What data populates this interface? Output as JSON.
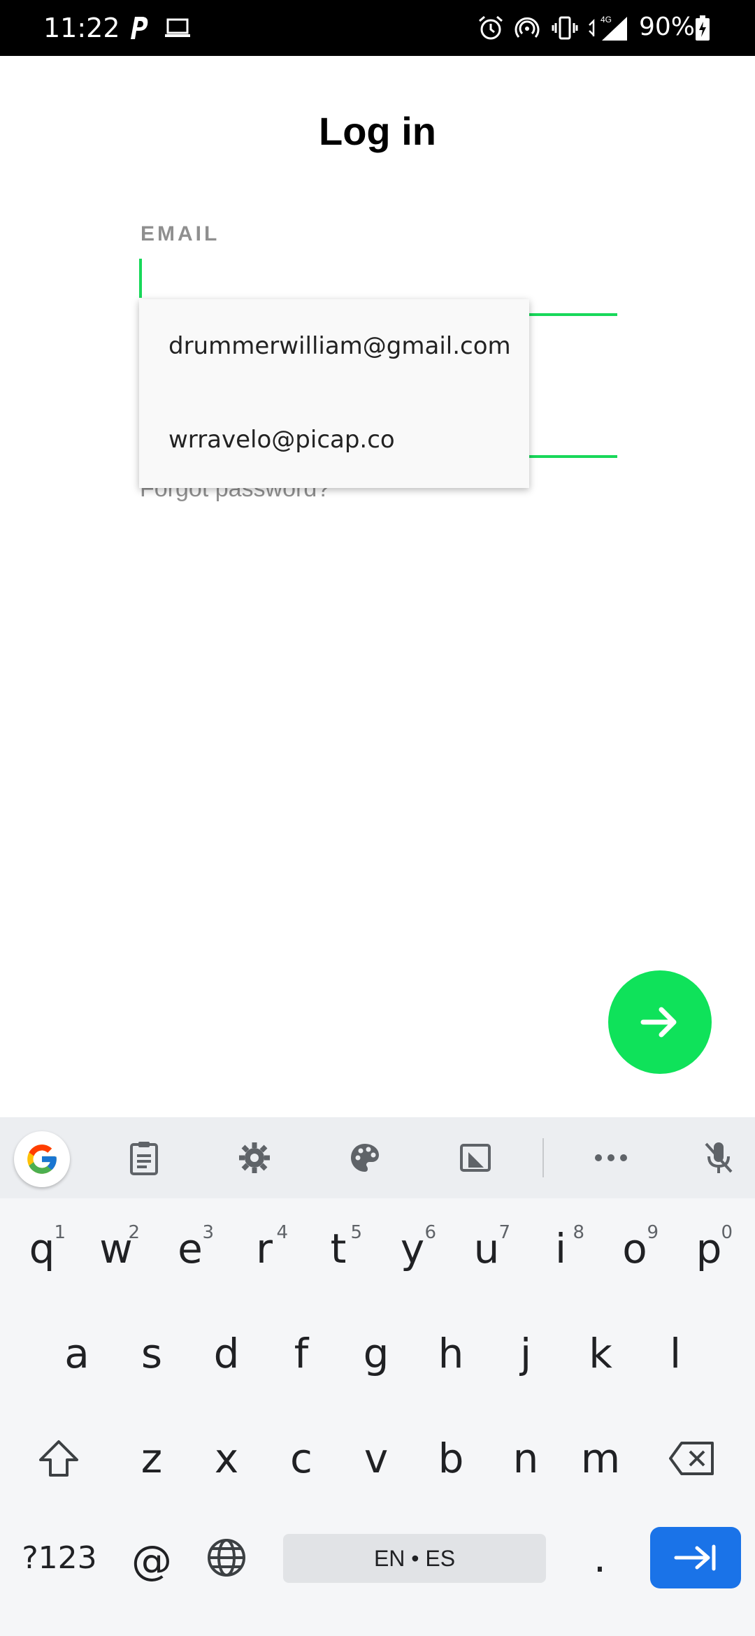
{
  "status_bar": {
    "time": "11:22",
    "battery": "90%",
    "network": "4G",
    "left_icons": [
      "parking-app-icon",
      "laptop-icon"
    ],
    "right_icons": [
      "alarm-icon",
      "hotspot-icon",
      "vibrate-icon",
      "signal-icon",
      "battery-icon"
    ]
  },
  "login": {
    "title": "Log in",
    "email_label": "EMAIL",
    "email_value": "",
    "forgot_password": "Forgot password?",
    "next_icon": "arrow-right-icon"
  },
  "autofill": {
    "items": [
      "drummerwilliam@gmail.com",
      "wrravelo@picap.co"
    ]
  },
  "keyboard": {
    "toolbar_icons": [
      "google-icon",
      "clipboard-icon",
      "settings-icon",
      "palette-icon",
      "floating-keyboard-icon",
      "more-icon",
      "mic-off-icon"
    ],
    "row1": [
      {
        "k": "q",
        "h": "1"
      },
      {
        "k": "w",
        "h": "2"
      },
      {
        "k": "e",
        "h": "3"
      },
      {
        "k": "r",
        "h": "4"
      },
      {
        "k": "t",
        "h": "5"
      },
      {
        "k": "y",
        "h": "6"
      },
      {
        "k": "u",
        "h": "7"
      },
      {
        "k": "i",
        "h": "8"
      },
      {
        "k": "o",
        "h": "9"
      },
      {
        "k": "p",
        "h": "0"
      }
    ],
    "row2": [
      "a",
      "s",
      "d",
      "f",
      "g",
      "h",
      "j",
      "k",
      "l"
    ],
    "row3": [
      "z",
      "x",
      "c",
      "v",
      "b",
      "n",
      "m"
    ],
    "symbols_label": "?123",
    "at_label": "@",
    "space_label": "EN • ES",
    "period_label": ".",
    "accent_color": "#18d85a",
    "enter_color": "#1a73e8"
  }
}
